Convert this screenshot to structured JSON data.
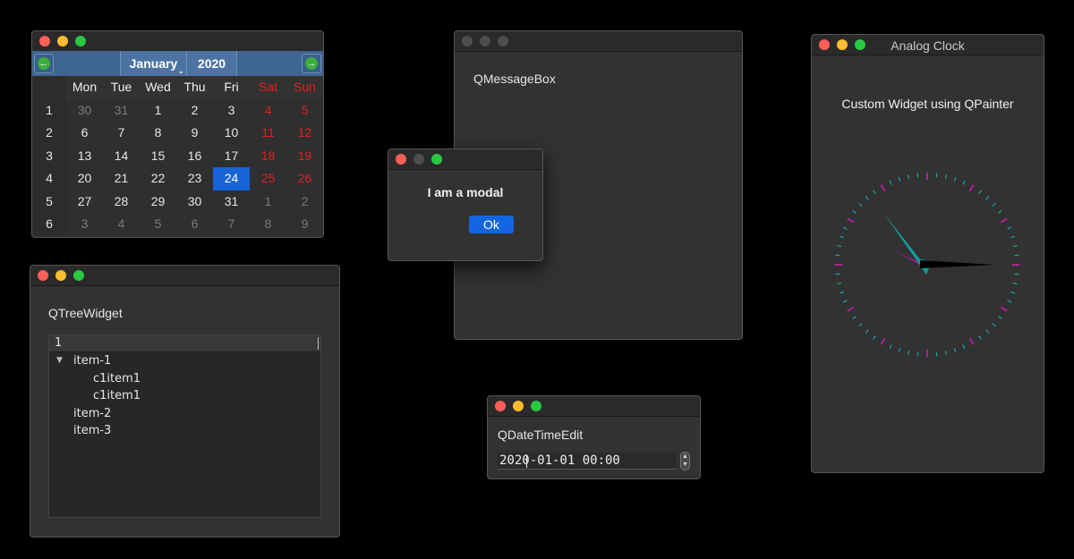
{
  "calendar": {
    "month": "January",
    "year": "2020",
    "weekdays": [
      "Mon",
      "Tue",
      "Wed",
      "Thu",
      "Fri",
      "Sat",
      "Sun"
    ],
    "weeks": [
      {
        "num": "1",
        "days": [
          "30",
          "31",
          "1",
          "2",
          "3",
          "4",
          "5"
        ]
      },
      {
        "num": "2",
        "days": [
          "6",
          "7",
          "8",
          "9",
          "10",
          "11",
          "12"
        ]
      },
      {
        "num": "3",
        "days": [
          "13",
          "14",
          "15",
          "16",
          "17",
          "18",
          "19"
        ]
      },
      {
        "num": "4",
        "days": [
          "20",
          "21",
          "22",
          "23",
          "24",
          "25",
          "26"
        ]
      },
      {
        "num": "5",
        "days": [
          "27",
          "28",
          "29",
          "30",
          "31",
          "1",
          "2"
        ]
      },
      {
        "num": "6",
        "days": [
          "3",
          "4",
          "5",
          "6",
          "7",
          "8",
          "9"
        ]
      }
    ],
    "selected_day": "24",
    "weekend_color": "#e11f1f",
    "selected_color": "#1863d6",
    "nav_color": "#3f6591"
  },
  "tree_window": {
    "heading": "QTreeWidget",
    "header": "1",
    "items": [
      {
        "label": "item-1",
        "level": 0,
        "expanded": true
      },
      {
        "label": "c1item1",
        "level": 1
      },
      {
        "label": "c1item1",
        "level": 1
      },
      {
        "label": "item-2",
        "level": 0
      },
      {
        "label": "item-3",
        "level": 0
      }
    ]
  },
  "msgbox_window": {
    "label": "QMessageBox"
  },
  "modal": {
    "text": "I am a modal",
    "ok_label": "Ok",
    "button_color": "#1366e0"
  },
  "datetime_window": {
    "label": "QDateTimeEdit",
    "value": "2020-01-01 00:00"
  },
  "clock_window": {
    "title": "Analog Clock",
    "heading": "Custom Widget using QPainter",
    "tick_color_minor": "#1aa3a3",
    "tick_color_major": "#b0209c",
    "hour_hand_color": "#149a9a",
    "minute_hand_color": "#a01896",
    "second_hand_color": "#000000"
  },
  "icons": {
    "prev": "arrow-left-icon",
    "next": "arrow-right-icon",
    "expand": "triangle-down-icon",
    "stepper": "up-down-icon"
  }
}
